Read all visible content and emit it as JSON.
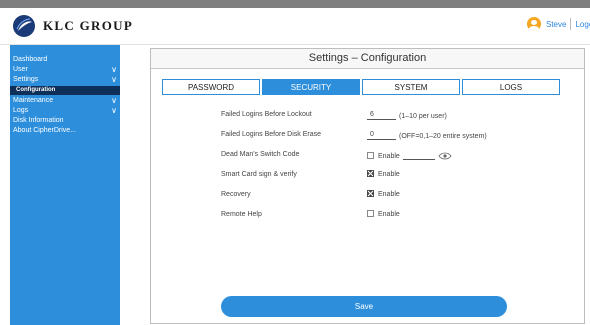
{
  "brand": {
    "name": "KLC GROUP"
  },
  "user": {
    "name": "Steve",
    "logout": "Logout"
  },
  "sidebar": {
    "items": [
      {
        "label": "Dashboard",
        "chevron": false
      },
      {
        "label": "User",
        "chevron": true
      },
      {
        "label": "Settings",
        "chevron": true
      },
      {
        "label": "Configuration",
        "sub": true,
        "selected": true
      },
      {
        "label": "Maintenance",
        "chevron": true
      },
      {
        "label": "Logs",
        "chevron": true
      },
      {
        "label": "Disk Information",
        "chevron": false
      },
      {
        "label": "About CipherDrive...",
        "chevron": false
      }
    ]
  },
  "page": {
    "title": "Settings – Configuration"
  },
  "tabs": [
    {
      "label": "PASSWORD",
      "active": false
    },
    {
      "label": "SECURITY",
      "active": true
    },
    {
      "label": "SYSTEM",
      "active": false
    },
    {
      "label": "LOGS",
      "active": false
    }
  ],
  "settings": {
    "failed_logins_lockout": {
      "label": "Failed Logins Before Lockout",
      "value": "6",
      "hint": "(1–10 per user)"
    },
    "failed_logins_erase": {
      "label": "Failed Logins Before Disk Erase",
      "value": "0",
      "hint": "(OFF=0,1–20 entire system)"
    },
    "dead_mans_switch": {
      "label": "Dead Man's Switch Code",
      "checkbox_label": "Enable",
      "checked": false
    },
    "smart_card": {
      "label": "Smart Card sign & verify",
      "checkbox_label": "Enable",
      "checked": true
    },
    "recovery": {
      "label": "Recovery",
      "checkbox_label": "Enable",
      "checked": true
    },
    "remote_help": {
      "label": "Remote Help",
      "checkbox_label": "Enable",
      "checked": false
    }
  },
  "actions": {
    "save_label": "Save"
  },
  "colors": {
    "accent": "#2d8fdc",
    "sidebar_selected": "#0d2f58",
    "user_avatar": "#f5a623"
  },
  "icons": {
    "brand": "klc-logo-icon",
    "user": "user-avatar-icon",
    "reveal": "eye-icon",
    "expand": "chevron-down-icon"
  }
}
